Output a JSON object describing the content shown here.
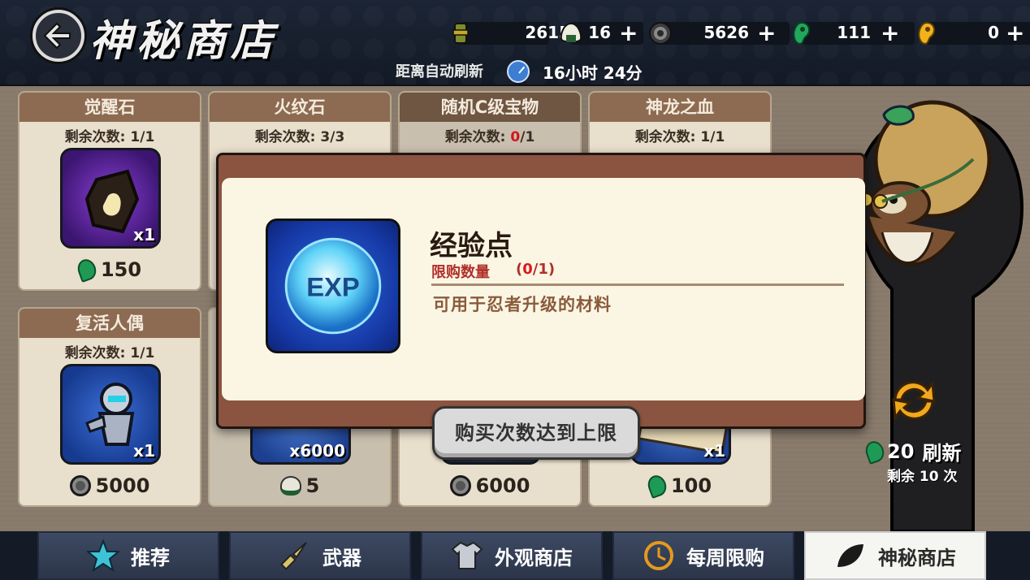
{
  "header": {
    "title": "神秘商店",
    "refresh_label": "距离自动刷新",
    "refresh_time": "16小时 24分"
  },
  "resources": [
    {
      "icon": "scroll-icon",
      "value": "2615",
      "has_plus": false
    },
    {
      "icon": "rice-ball-icon",
      "value": "16",
      "has_plus": true
    },
    {
      "icon": "coin-icon",
      "value": "5626",
      "has_plus": true
    },
    {
      "icon": "green-jade-icon",
      "value": "111",
      "has_plus": true
    },
    {
      "icon": "gold-jade-icon",
      "value": "0",
      "has_plus": true
    }
  ],
  "cards": [
    {
      "name": "觉醒石",
      "remain_label": "剩余次数:",
      "remain_used": "1",
      "remain_total": "/1",
      "qty": "x1",
      "price": "150",
      "currency": "jade"
    },
    {
      "name": "火纹石",
      "remain_label": "剩余次数:",
      "remain_used": "3",
      "remain_total": "/3"
    },
    {
      "name": "随机C级宝物",
      "remain_label": "剩余次数:",
      "remain_used": "0",
      "remain_total": "/1"
    },
    {
      "name": "神龙之血",
      "remain_label": "剩余次数:",
      "remain_used": "1",
      "remain_total": "/1"
    },
    {
      "name": "复活人偶",
      "remain_label": "剩余次数:",
      "remain_used": "1",
      "remain_total": "/1",
      "qty": "x1",
      "price": "5000",
      "currency": "coin"
    },
    {
      "qty": "x6000",
      "price": "5",
      "currency": "rice"
    },
    {
      "price": "6000",
      "currency": "coin"
    },
    {
      "qty": "x1",
      "price": "100",
      "currency": "jade"
    }
  ],
  "refresh": {
    "cost": "20",
    "label": "刷新",
    "remain": "剩余 10 次"
  },
  "modal": {
    "item_name": "经验点",
    "icon_text": "EXP",
    "limit_label": "限购数量",
    "limit_open": "(",
    "limit_used": "0",
    "limit_total": "/1)",
    "description": "可用于忍者升级的材料",
    "button_label": "购买次数达到上限"
  },
  "tabs": [
    {
      "label": "推荐",
      "icon": "star-icon",
      "active": false
    },
    {
      "label": "武器",
      "icon": "kunai-icon",
      "active": false
    },
    {
      "label": "外观商店",
      "icon": "shirt-icon",
      "active": false
    },
    {
      "label": "每周限购",
      "icon": "clock-icon",
      "active": false
    },
    {
      "label": "神秘商店",
      "icon": "leaf-icon",
      "active": true
    }
  ],
  "colors": {
    "accent_red": "#e0141d",
    "jade_green": "#1e9a55",
    "card_header": "#8c6b52"
  }
}
